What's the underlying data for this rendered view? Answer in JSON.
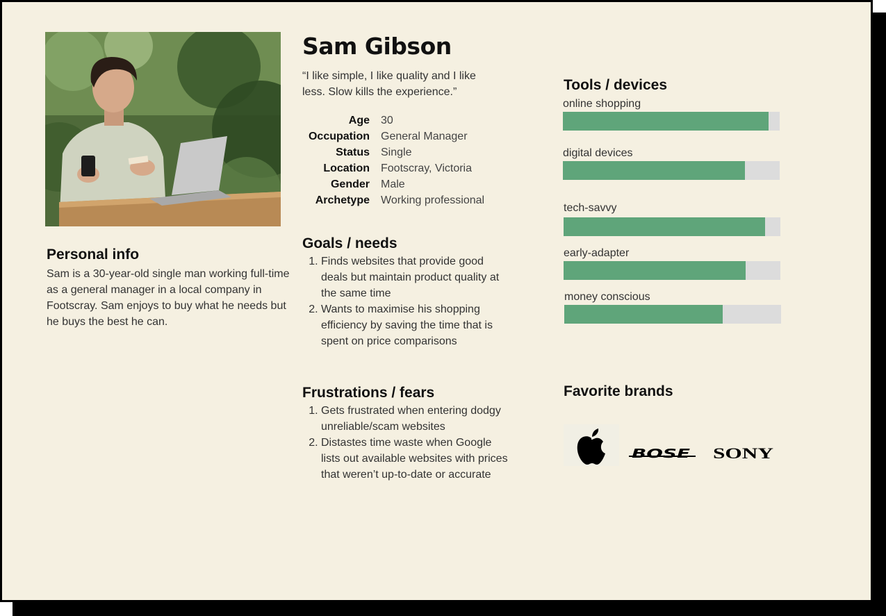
{
  "persona": {
    "name": "Sam Gibson",
    "quote": "“I like simple, I like quality and I like less. Slow kills the experience.”",
    "details": [
      {
        "label": "Age",
        "value": "30"
      },
      {
        "label": "Occupation",
        "value": "General Manager"
      },
      {
        "label": "Status",
        "value": "Single"
      },
      {
        "label": "Location",
        "value": "Footscray, Victoria"
      },
      {
        "label": "Gender",
        "value": "Male"
      },
      {
        "label": "Archetype",
        "value": "Working professional"
      }
    ]
  },
  "personal_info": {
    "heading": "Personal info",
    "text": "Sam is a 30-year-old single man working full-time as a general manager in a local company in Footscray. Sam enjoys to buy what he needs but he buys the best he can."
  },
  "goals": {
    "heading": "Goals / needs",
    "items": [
      "Finds websites that provide good deals but maintain product quality at the same time",
      "Wants to maximise his shopping efficiency by saving the time that is spent on price comparisons"
    ]
  },
  "frustrations": {
    "heading": "Frustrations / fears",
    "items": [
      "Gets frustrated when entering dodgy unreliable/scam websites",
      "Distastes time waste when Google lists out available websites with prices that weren’t up-to-date or accurate"
    ]
  },
  "tools": {
    "heading": "Tools / devices",
    "bars": [
      {
        "label": "online shopping",
        "value": 0.95
      },
      {
        "label": "digital devices",
        "value": 0.84
      },
      {
        "label": "tech-savvy",
        "value": 0.93
      },
      {
        "label": "early-adapter",
        "value": 0.84
      },
      {
        "label": "money conscious",
        "value": 0.73
      }
    ],
    "bar_color": "#5fa57a",
    "track_color": "#dcdcdc"
  },
  "brands": {
    "heading": "Favorite brands",
    "logos": [
      {
        "icon": "apple-logo-icon",
        "name": "Apple"
      },
      {
        "icon": "bose-logo-icon",
        "name": "BOSE"
      },
      {
        "icon": "sony-logo-icon",
        "name": "SONY"
      }
    ]
  },
  "colors": {
    "card_background": "#f5f0e1",
    "accent": "#5fa57a"
  }
}
